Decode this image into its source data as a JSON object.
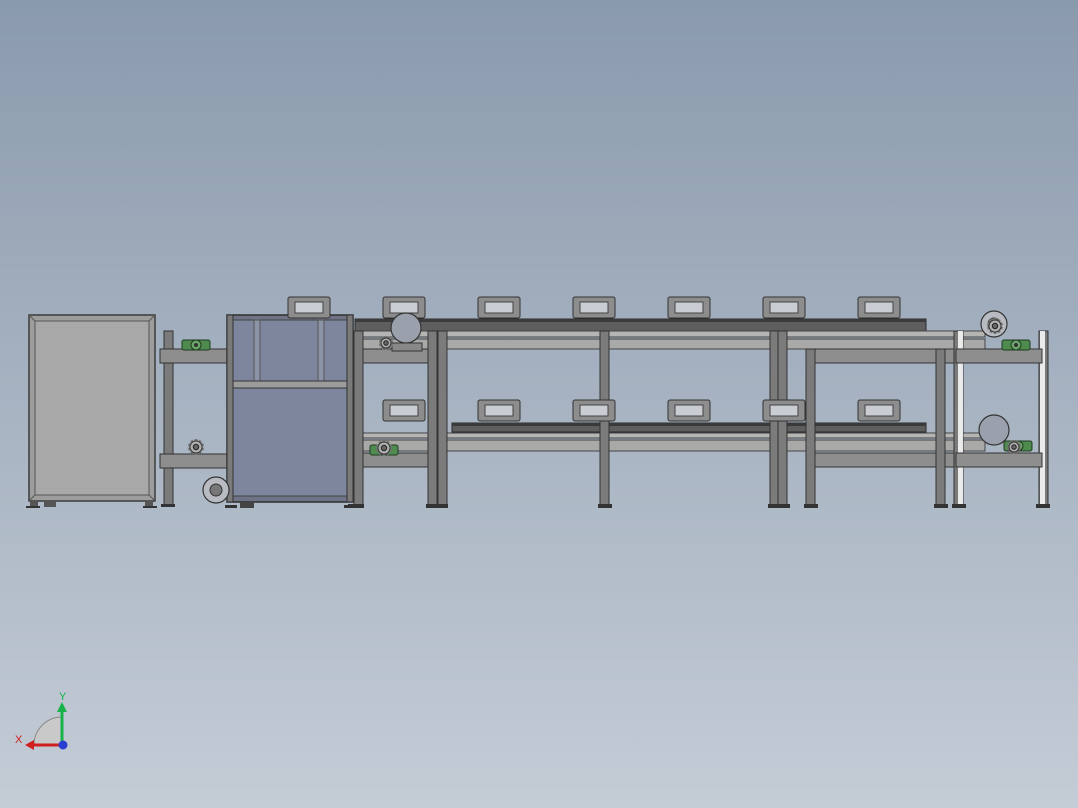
{
  "viewport": {
    "background_top": "#8a9aad",
    "background_bottom": "#c4ccd6"
  },
  "colors": {
    "frame": "#6f6f6f",
    "frame_dark": "#3b3b3b",
    "panel_gray": "#a8a8a8",
    "panel_blue": "#7e869e",
    "rail": "#a9aaa8",
    "belt": "#444444",
    "bearing_green": "#4f8a4f",
    "motor": "#9aa1ad"
  },
  "triad": {
    "x_label": "X",
    "y_label": "Y",
    "x_color": "#d01f1f",
    "y_color": "#18b24a",
    "z_color": "#2a3fd0"
  },
  "icons": {
    "triad": "coordinate-triad-icon",
    "bearing": "pillow-block-bearing-icon",
    "sprocket": "sprocket-gear-icon",
    "motor": "motor-icon"
  }
}
